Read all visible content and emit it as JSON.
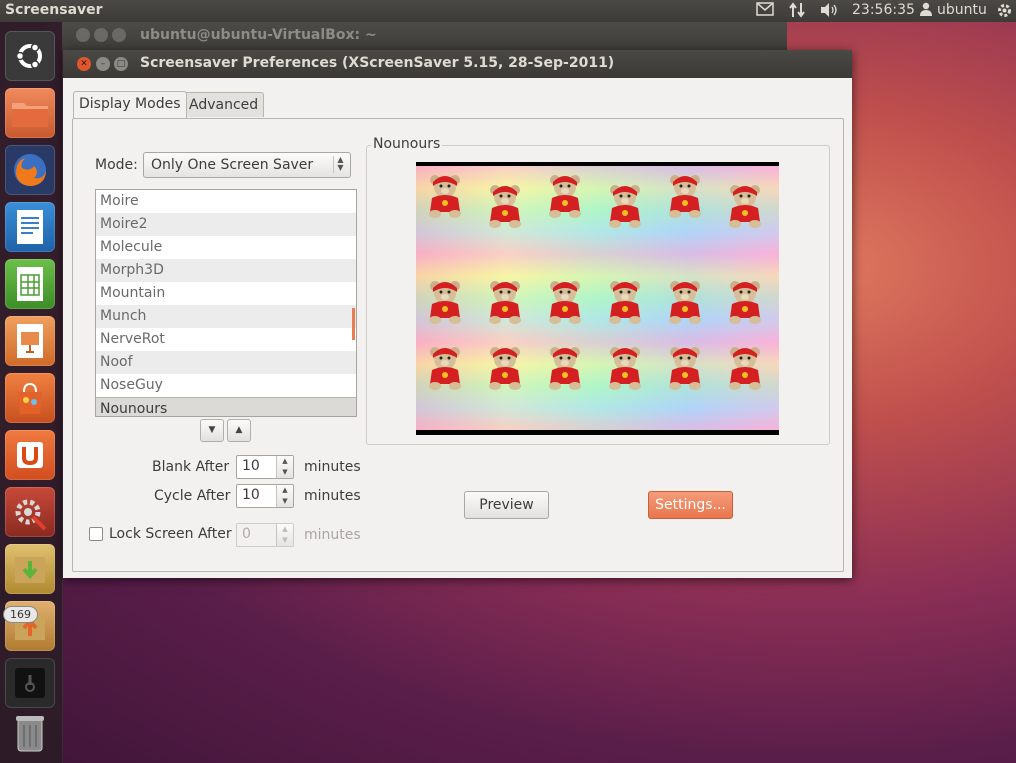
{
  "topbar": {
    "app_title": "Screensaver",
    "clock": "23:56:35",
    "user": "ubuntu"
  },
  "launcher": {
    "items": [
      {
        "icon": "ubuntu-dash-icon"
      },
      {
        "icon": "home-folder-icon"
      },
      {
        "icon": "firefox-icon"
      },
      {
        "icon": "libreoffice-writer-icon"
      },
      {
        "icon": "libreoffice-calc-icon"
      },
      {
        "icon": "libreoffice-impress-icon"
      },
      {
        "icon": "software-center-icon"
      },
      {
        "icon": "ubuntu-one-icon"
      },
      {
        "icon": "system-settings-icon"
      },
      {
        "icon": "workspace-switcher-icon"
      },
      {
        "icon": "update-manager-icon"
      },
      {
        "icon": "screensaver-app-icon"
      },
      {
        "icon": "trash-icon"
      }
    ],
    "update_badge": "169"
  },
  "terminal": {
    "title": "ubuntu@ubuntu-VirtualBox: ~"
  },
  "dialog": {
    "title": "Screensaver Preferences  (XScreenSaver 5.15, 28-Sep-2011)",
    "tabs": [
      {
        "label": "Display Modes",
        "active": true
      },
      {
        "label": "Advanced",
        "active": false
      }
    ],
    "mode_label": "Mode:",
    "mode_value": "Only One Screen Saver",
    "saver_list": [
      "Moire",
      "Moire2",
      "Molecule",
      "Morph3D",
      "Mountain",
      "Munch",
      "NerveRot",
      "Noof",
      "NoseGuy",
      "Nounours"
    ],
    "selected_saver": "Nounours",
    "blank_after_label": "Blank After",
    "blank_after_value": "10",
    "cycle_after_label": "Cycle After",
    "cycle_after_value": "10",
    "lock_label": "Lock Screen After",
    "lock_value": "0",
    "minutes_label": "minutes",
    "preview_group_title": "Nounours",
    "preview_button": "Preview",
    "settings_button": "Settings..."
  },
  "colors": {
    "accent": "#e8764d",
    "panel": "#3c3b37",
    "dialog_bg": "#f2f1f0"
  }
}
